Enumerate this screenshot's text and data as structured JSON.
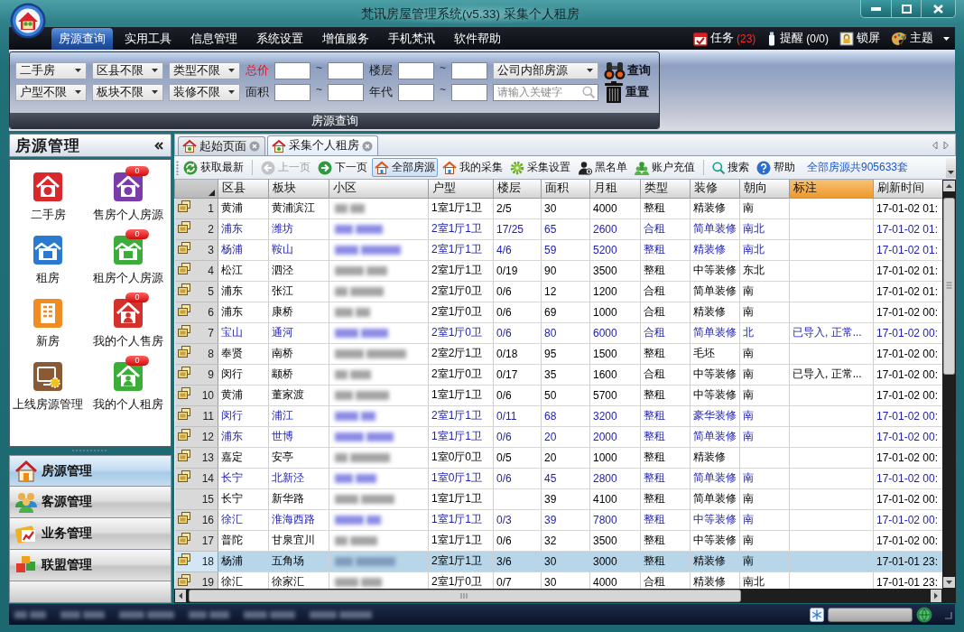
{
  "window": {
    "title": "梵讯房屋管理系统(v5.33) 采集个人租房"
  },
  "menu": [
    {
      "label": "房源查询",
      "selected": true
    },
    {
      "label": "实用工具",
      "selected": false
    },
    {
      "label": "信息管理",
      "selected": false
    },
    {
      "label": "系统设置",
      "selected": false
    },
    {
      "label": "增值服务",
      "selected": false
    },
    {
      "label": "手机梵讯",
      "selected": false
    },
    {
      "label": "软件帮助",
      "selected": false
    }
  ],
  "menu_right": [
    {
      "kind": "calendar",
      "label": "任务",
      "count": {
        "text": "(23)",
        "alert": true
      },
      "dropdown": false
    },
    {
      "kind": "note",
      "label": "提醒",
      "count": {
        "text": "(0/0)",
        "alert": false
      },
      "dropdown": false
    },
    {
      "kind": "lock",
      "label": "锁屏",
      "dropdown": false
    },
    {
      "kind": "palette",
      "label": "主题",
      "dropdown": true
    }
  ],
  "filter_panel": {
    "rows": [
      {
        "selects": [
          "二手房",
          "区县不限",
          "类型不限"
        ],
        "ranges": [
          {
            "label": "总价",
            "highlighted": true,
            "separator": "~"
          },
          {
            "label": "楼层",
            "highlighted": false,
            "separator": "~"
          }
        ],
        "field": {
          "kind": "select",
          "value": "公司内部房源"
        },
        "button": {
          "label": "查询",
          "kind": "binoculars"
        }
      },
      {
        "selects": [
          "户型不限",
          "板块不限",
          "装修不限"
        ],
        "ranges": [
          {
            "label": "面积",
            "highlighted": false,
            "separator": "~"
          },
          {
            "label": "年代",
            "highlighted": false,
            "separator": "~"
          }
        ],
        "field": {
          "kind": "search",
          "placeholder": "请输入关键字"
        },
        "button": {
          "label": "重置",
          "kind": "trash"
        }
      }
    ],
    "caption": "房源查询"
  },
  "sidebar": {
    "title": "房源管理",
    "tiles": [
      {
        "label": "二手房",
        "kind": "sale",
        "color": "#d8282c"
      },
      {
        "label": "售房个人房源",
        "kind": "sale",
        "color": "#7b3ba8",
        "badge": "0"
      },
      {
        "label": "租房",
        "kind": "rent",
        "color": "#2a7ad2"
      },
      {
        "label": "租房个人房源",
        "kind": "rent",
        "color": "#3cad3a",
        "badge": "0"
      },
      {
        "label": "新房",
        "kind": "building",
        "color": "#f08c22"
      },
      {
        "label": "我的个人售房",
        "kind": "person",
        "color": "#d4302c",
        "badge": "0"
      },
      {
        "label": "上线房源管理",
        "kind": "monitor",
        "color": "#8a5a34"
      },
      {
        "label": "我的个人租房",
        "kind": "person",
        "color": "#3cad3a",
        "badge": "0"
      }
    ],
    "nav": [
      {
        "label": "房源管理",
        "kind": "house",
        "selected": true
      },
      {
        "label": "客源管理",
        "kind": "people",
        "selected": false
      },
      {
        "label": "业务管理",
        "kind": "folder",
        "selected": false
      },
      {
        "label": "联盟管理",
        "kind": "cubes",
        "selected": false
      }
    ]
  },
  "tabs": [
    {
      "label": "起始页面",
      "selected": false
    },
    {
      "label": "采集个人租房",
      "selected": true
    }
  ],
  "toolbar": {
    "items": [
      {
        "kind": "refresh",
        "label": "获取最新",
        "disabled": false,
        "selected": false
      },
      {
        "kind": "separator"
      },
      {
        "kind": "back",
        "label": "上一页",
        "disabled": true,
        "selected": false
      },
      {
        "kind": "forward",
        "label": "下一页",
        "disabled": false,
        "selected": false
      },
      {
        "kind": "house",
        "label": "全部房源",
        "disabled": false,
        "selected": true
      },
      {
        "kind": "house",
        "label": "我的采集",
        "disabled": false,
        "selected": false
      },
      {
        "kind": "gear",
        "label": "采集设置",
        "disabled": false,
        "selected": false
      },
      {
        "kind": "person",
        "label": "黑名单",
        "disabled": false,
        "selected": false
      },
      {
        "kind": "people",
        "label": "账户充值",
        "disabled": false,
        "selected": false
      },
      {
        "kind": "separator"
      },
      {
        "kind": "search",
        "label": "搜索",
        "disabled": false,
        "selected": false
      },
      {
        "kind": "help",
        "label": "帮助",
        "disabled": false,
        "selected": false
      }
    ],
    "summary": "全部房源共905633套"
  },
  "table": {
    "columns": [
      {
        "label": "区县",
        "kind": "text",
        "selected": false
      },
      {
        "label": "板块",
        "kind": "text",
        "selected": false
      },
      {
        "label": "小区",
        "kind": "blurred",
        "selected": false
      },
      {
        "label": "户型",
        "kind": "text",
        "selected": false
      },
      {
        "label": "楼层",
        "kind": "text",
        "selected": false
      },
      {
        "label": "面积",
        "kind": "text",
        "selected": false
      },
      {
        "label": "月租",
        "kind": "text",
        "selected": false
      },
      {
        "label": "类型",
        "kind": "text",
        "selected": false
      },
      {
        "label": "装修",
        "kind": "text",
        "selected": false
      },
      {
        "label": "朝向",
        "kind": "text",
        "selected": false
      },
      {
        "label": "标注",
        "kind": "text",
        "selected": true
      },
      {
        "label": "刷新时间",
        "kind": "text",
        "selected": false
      }
    ],
    "rows": [
      {
        "number": "1",
        "has_icon": true,
        "highlighted": false,
        "selected": false,
        "district": "黄浦",
        "block": "黄浦滨江",
        "layout": "1室1厅1卫",
        "floor": "2/5",
        "area": "30",
        "rent": "4000",
        "type": "整租",
        "decoration": "精装修",
        "orientation": "南",
        "refreshed": "17-01-02 01:"
      },
      {
        "number": "2",
        "has_icon": true,
        "highlighted": true,
        "selected": false,
        "district": "浦东",
        "block": "潍坊",
        "layout": "2室1厅1卫",
        "floor": "17/25",
        "area": "65",
        "rent": "2600",
        "type": "合租",
        "decoration": "简单装修",
        "orientation": "南北",
        "refreshed": "17-01-02 01:"
      },
      {
        "number": "3",
        "has_icon": true,
        "highlighted": true,
        "selected": false,
        "district": "杨浦",
        "block": "鞍山",
        "layout": "2室1厅1卫",
        "floor": "4/6",
        "area": "59",
        "rent": "5200",
        "type": "整租",
        "decoration": "精装修",
        "orientation": "南北",
        "refreshed": "17-01-02 01:"
      },
      {
        "number": "4",
        "has_icon": true,
        "highlighted": false,
        "selected": false,
        "district": "松江",
        "block": "泗泾",
        "layout": "2室1厅1卫",
        "floor": "0/19",
        "area": "90",
        "rent": "3500",
        "type": "整租",
        "decoration": "中等装修",
        "orientation": "东北",
        "refreshed": "17-01-02 01:"
      },
      {
        "number": "5",
        "has_icon": true,
        "highlighted": false,
        "selected": false,
        "district": "浦东",
        "block": "张江",
        "layout": "2室1厅0卫",
        "floor": "0/6",
        "area": "12",
        "rent": "1200",
        "type": "合租",
        "decoration": "简单装修",
        "orientation": "南",
        "refreshed": "17-01-02 01:"
      },
      {
        "number": "6",
        "has_icon": true,
        "highlighted": false,
        "selected": false,
        "district": "浦东",
        "block": "康桥",
        "layout": "2室1厅0卫",
        "floor": "0/6",
        "area": "69",
        "rent": "1000",
        "type": "合租",
        "decoration": "精装修",
        "orientation": "南",
        "refreshed": "17-01-02 00:"
      },
      {
        "number": "7",
        "has_icon": true,
        "highlighted": true,
        "selected": false,
        "district": "宝山",
        "block": "通河",
        "layout": "2室1厅0卫",
        "floor": "0/6",
        "area": "80",
        "rent": "6000",
        "type": "合租",
        "decoration": "简单装修",
        "orientation": "北",
        "note": "已导入, 正常...",
        "refreshed": "17-01-02 00:"
      },
      {
        "number": "8",
        "has_icon": true,
        "highlighted": false,
        "selected": false,
        "district": "奉贤",
        "block": "南桥",
        "layout": "2室2厅1卫",
        "floor": "0/18",
        "area": "95",
        "rent": "1500",
        "type": "整租",
        "decoration": "毛坯",
        "orientation": "南",
        "refreshed": "17-01-02 00:"
      },
      {
        "number": "9",
        "has_icon": true,
        "highlighted": false,
        "selected": false,
        "district": "闵行",
        "block": "颛桥",
        "layout": "2室1厅0卫",
        "floor": "0/17",
        "area": "35",
        "rent": "1600",
        "type": "合租",
        "decoration": "中等装修",
        "orientation": "南",
        "note": "已导入, 正常...",
        "refreshed": "17-01-02 00:"
      },
      {
        "number": "10",
        "has_icon": true,
        "highlighted": false,
        "selected": false,
        "district": "黄浦",
        "block": "董家渡",
        "layout": "1室1厅1卫",
        "floor": "0/6",
        "area": "50",
        "rent": "5700",
        "type": "整租",
        "decoration": "中等装修",
        "orientation": "南",
        "refreshed": "17-01-02 00:"
      },
      {
        "number": "11",
        "has_icon": true,
        "highlighted": true,
        "selected": false,
        "district": "闵行",
        "block": "浦江",
        "layout": "2室1厅1卫",
        "floor": "0/11",
        "area": "68",
        "rent": "3200",
        "type": "整租",
        "decoration": "豪华装修",
        "orientation": "南",
        "refreshed": "17-01-02 00:"
      },
      {
        "number": "12",
        "has_icon": true,
        "highlighted": true,
        "selected": false,
        "district": "浦东",
        "block": "世博",
        "layout": "1室1厅1卫",
        "floor": "0/6",
        "area": "20",
        "rent": "2000",
        "type": "整租",
        "decoration": "简单装修",
        "orientation": "南",
        "refreshed": "17-01-02 00:"
      },
      {
        "number": "13",
        "has_icon": true,
        "highlighted": false,
        "selected": false,
        "district": "嘉定",
        "block": "安亭",
        "layout": "1室0厅0卫",
        "floor": "0/5",
        "area": "20",
        "rent": "1000",
        "type": "整租",
        "decoration": "精装修",
        "refreshed": "17-01-02 00:"
      },
      {
        "number": "14",
        "has_icon": true,
        "highlighted": true,
        "selected": false,
        "district": "长宁",
        "block": "北新泾",
        "layout": "1室0厅1卫",
        "floor": "0/6",
        "area": "45",
        "rent": "2800",
        "type": "整租",
        "decoration": "简单装修",
        "orientation": "南",
        "refreshed": "17-01-02 00:"
      },
      {
        "number": "15",
        "has_icon": false,
        "highlighted": false,
        "selected": false,
        "district": "长宁",
        "block": "新华路",
        "layout": "1室1厅1卫",
        "area": "39",
        "rent": "4100",
        "type": "整租",
        "decoration": "简单装修",
        "orientation": "南",
        "refreshed": "17-01-02 00:"
      },
      {
        "number": "16",
        "has_icon": true,
        "highlighted": true,
        "selected": false,
        "district": "徐汇",
        "block": "淮海西路",
        "layout": "1室1厅1卫",
        "floor": "0/3",
        "area": "39",
        "rent": "7800",
        "type": "整租",
        "decoration": "中等装修",
        "orientation": "南",
        "refreshed": "17-01-02 00:"
      },
      {
        "number": "17",
        "has_icon": true,
        "highlighted": false,
        "selected": false,
        "district": "普陀",
        "block": "甘泉宜川",
        "layout": "1室1厅1卫",
        "floor": "0/6",
        "area": "32",
        "rent": "3500",
        "type": "整租",
        "decoration": "中等装修",
        "orientation": "南",
        "refreshed": "17-01-02 00:"
      },
      {
        "number": "18",
        "has_icon": true,
        "highlighted": false,
        "selected": true,
        "district": "杨浦",
        "block": "五角场",
        "layout": "2室1厅1卫",
        "floor": "3/6",
        "area": "30",
        "rent": "3000",
        "type": "整租",
        "decoration": "精装修",
        "orientation": "南",
        "refreshed": "17-01-01 23:"
      },
      {
        "number": "19",
        "has_icon": true,
        "highlighted": false,
        "selected": false,
        "district": "徐汇",
        "block": "徐家汇",
        "layout": "2室1厅0卫",
        "floor": "0/7",
        "area": "30",
        "rent": "4000",
        "type": "合租",
        "decoration": "精装修",
        "orientation": "南北",
        "refreshed": "17-01-01 23:"
      }
    ]
  }
}
